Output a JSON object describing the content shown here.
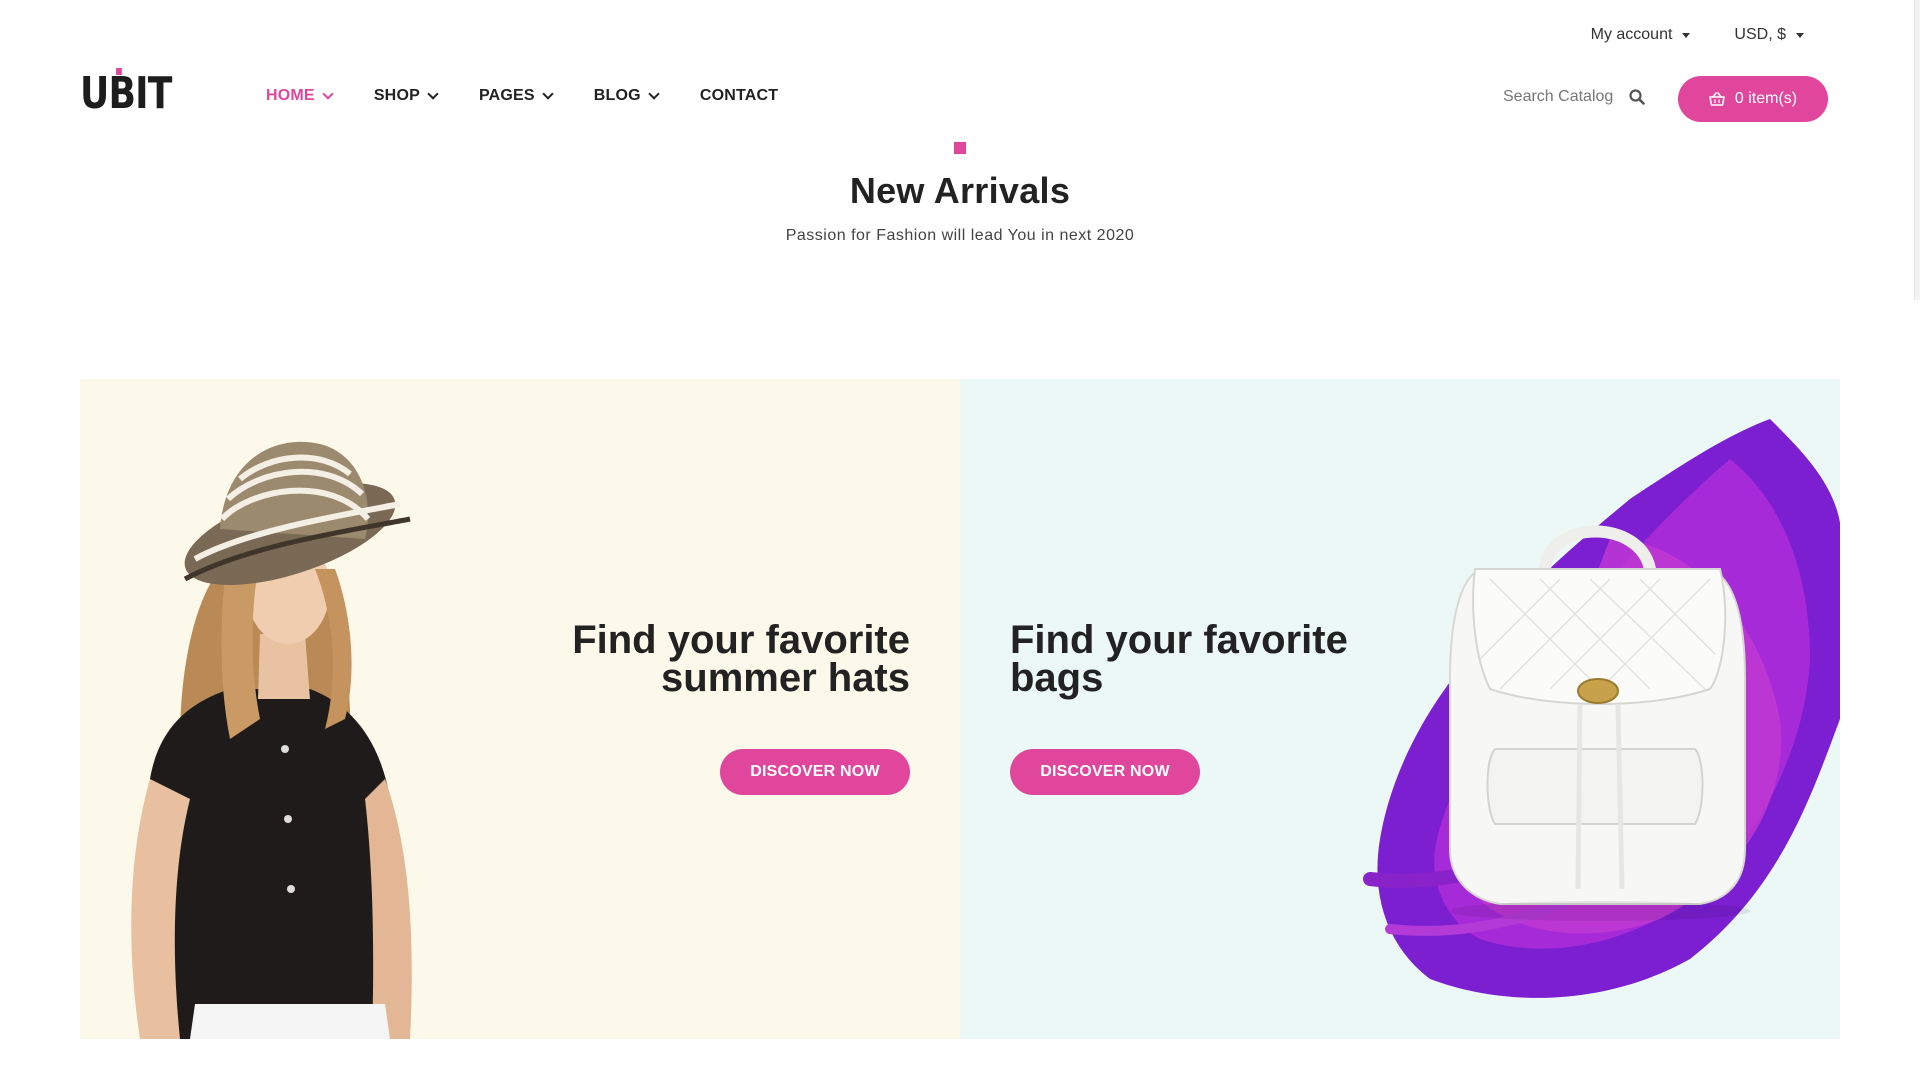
{
  "utility": {
    "account_label": "My account",
    "currency_label": "USD, $"
  },
  "header": {
    "logo_text": "UBIT",
    "nav": [
      {
        "label": "HOME",
        "active": true,
        "has_dropdown": true
      },
      {
        "label": "SHOP",
        "active": false,
        "has_dropdown": true
      },
      {
        "label": "PAGES",
        "active": false,
        "has_dropdown": true
      },
      {
        "label": "BLOG",
        "active": false,
        "has_dropdown": true
      },
      {
        "label": "CONTACT",
        "active": false,
        "has_dropdown": false
      }
    ],
    "search_placeholder": "Search Catalog",
    "cart_label": "0 item(s)"
  },
  "section": {
    "title": "New Arrivals",
    "subtitle": "Passion for Fashion will lead You in next 2020"
  },
  "banners": [
    {
      "line1": "Find your favorite",
      "line2": "summer hats",
      "button": "DISCOVER NOW",
      "background": "#fcf8ea",
      "image": "woman-in-hat"
    },
    {
      "line1": "Find your favorite",
      "line2": "bags",
      "button": "DISCOVER NOW",
      "background": "#ebf8f6",
      "image": "white-backpack"
    }
  ],
  "colors": {
    "accent": "#e0469c",
    "text": "#222222"
  },
  "icons": {
    "search": "search-icon",
    "cart": "basket-icon",
    "dropdown": "chevron-down-icon"
  }
}
